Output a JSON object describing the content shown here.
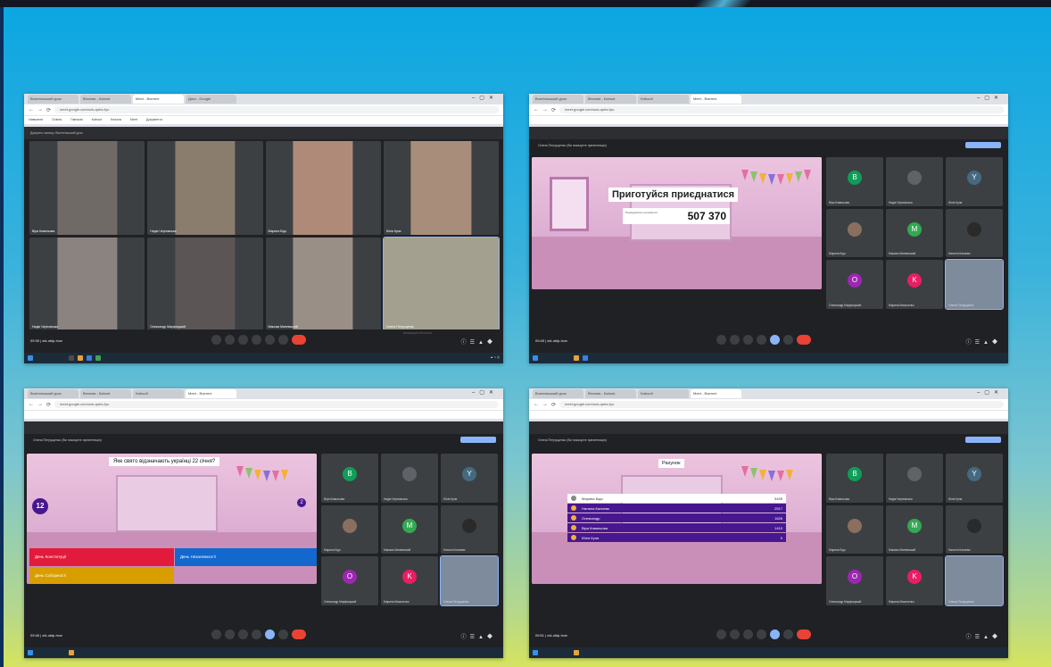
{
  "shots": [
    {
      "id": "meet-grid",
      "tabs": [
        "Вчительський урок",
        "Вітання - Kahoot",
        "Meet - Вчителі",
        "Диск - Google"
      ],
      "url": "meet.google.com/uzk-qwbc-fyu",
      "bookmarks": [
        "Навчання",
        "Освіта",
        "Гімназія",
        "Kahoot",
        "Класна",
        "Meet",
        "Документи"
      ],
      "meet_header": "Джерело запису: Вчительський урок",
      "participants": [
        {
          "name": "Віра Ковальова",
          "tone": "#6f6a66"
        },
        {
          "name": "Надія Черновська",
          "tone": "#8a7d6e"
        },
        {
          "name": "Марина Бідо",
          "tone": "#b08a78"
        },
        {
          "name": "Юлія Купа",
          "tone": "#a88e7a"
        },
        {
          "name": "Надія Черновська",
          "tone": "#8b8380"
        },
        {
          "name": "Олександр Марфицький",
          "tone": "#5b5655"
        },
        {
          "name": "Максим Маневський",
          "tone": "#9a8f86"
        },
        {
          "name": "Олена Петрущенко",
          "tone": "#a3a090"
        }
      ],
      "time": "09:35 | xid-ublp-hvw",
      "watermark": "Активация Windows"
    },
    {
      "id": "kahoot-join",
      "tabs": [
        "Вчительський урок",
        "Вітання - Kahoot",
        "Kahoot!",
        "Meet - Вчителі"
      ],
      "url": "meet.google.com/uzk-qwbc-fyu",
      "presenter": "Олена Петрущенко (Ви показуєте презентацію)",
      "present_title": "Приготуйся приєднатися",
      "join_label": "Приєднуйтесь на kahoot.it",
      "game_pin": "507 370",
      "side": [
        {
          "name": "Віра Ковальова",
          "letter": "В",
          "color": "#0f9d58"
        },
        {
          "name": "Надія Черновська",
          "letter": "",
          "color": "#5f6368"
        },
        {
          "name": "Юлія Купа",
          "letter": "Y",
          "color": "#456a80"
        },
        {
          "name": "Марина Бідо",
          "letter": "",
          "color": "#8a6f5e"
        },
        {
          "name": "Максим Маневський",
          "letter": "M",
          "color": "#34a853"
        },
        {
          "name": "Наталія Калиняк",
          "letter": "",
          "color": "#2a2a2a"
        },
        {
          "name": "Олександр Марфицький",
          "letter": "O",
          "color": "#9c27b0"
        },
        {
          "name": "Марина Масиченко",
          "letter": "K",
          "color": "#e91e63"
        },
        {
          "name": "Олена Петрущенко",
          "letter": "",
          "color": "#7d8b9c"
        }
      ],
      "time": "09:45 | xid-ublp-hvw"
    },
    {
      "id": "kahoot-question",
      "question": "Яке свято відзначають українці 22 січня?",
      "timer": "12",
      "answers_count": "2",
      "answers": [
        {
          "text": "День Конституції",
          "color": "#e21b3c"
        },
        {
          "text": "День Незалежності",
          "color": "#1368ce"
        },
        {
          "text": "День Соборності",
          "color": "#d89e00"
        }
      ],
      "time": "09:48 | xid-ublp-hvw"
    },
    {
      "id": "kahoot-scoreboard",
      "scoreboard_title": "Рахунок",
      "rows": [
        {
          "name": "Марина Бідо",
          "score": "5439",
          "color": "#ffffff",
          "text": "#333333"
        },
        {
          "name": "Наталія Калиняк",
          "score": "2517",
          "color": "#46178f",
          "text": "#ffffff"
        },
        {
          "name": "Олександр",
          "score": "1626",
          "color": "#46178f",
          "text": "#ffffff"
        },
        {
          "name": "Віра Ковальова",
          "score": "1410",
          "color": "#46178f",
          "text": "#ffffff"
        },
        {
          "name": "Юлія Купа",
          "score": "0",
          "color": "#46178f",
          "text": "#ffffff"
        }
      ],
      "time": "09:51 | xid-ublp-hvw"
    }
  ]
}
